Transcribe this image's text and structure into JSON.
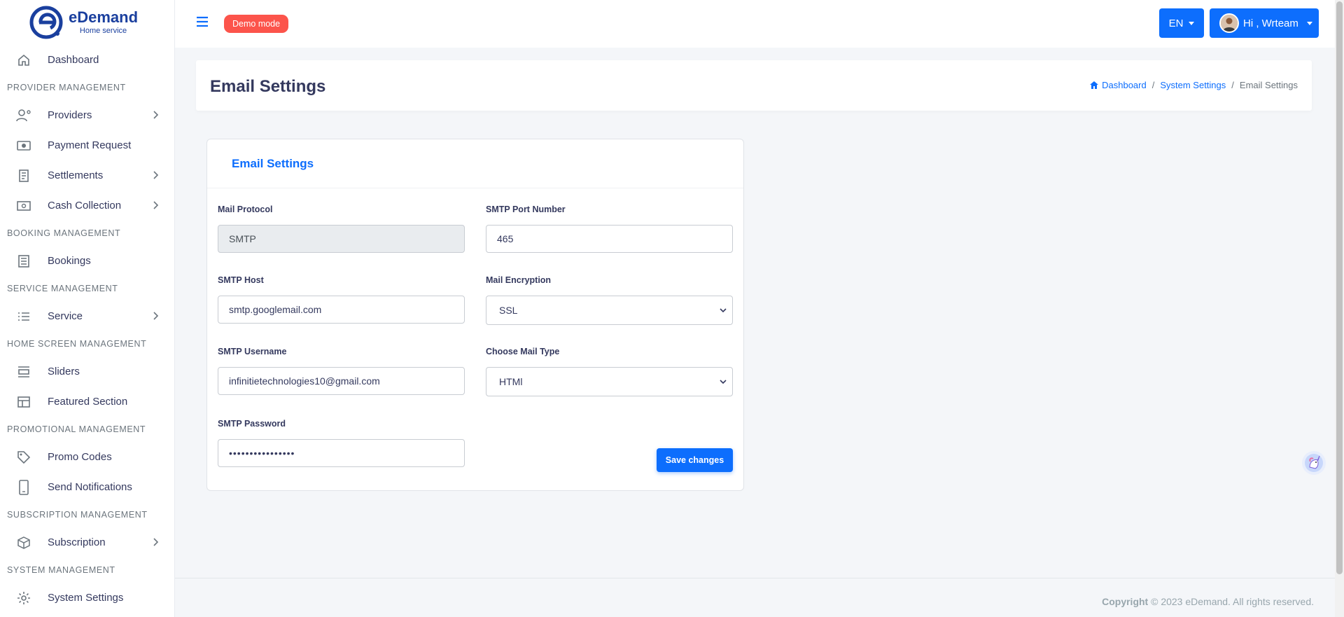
{
  "brand": {
    "name": "eDemand",
    "subtitle": "Home service"
  },
  "sidebar": {
    "items": [
      {
        "type": "item",
        "label": "Dashboard",
        "icon": "home-icon"
      },
      {
        "type": "header",
        "label": "PROVIDER MANAGEMENT"
      },
      {
        "type": "item",
        "label": "Providers",
        "icon": "user-gear-icon",
        "submenu": true
      },
      {
        "type": "item",
        "label": "Payment Request",
        "icon": "money-icon"
      },
      {
        "type": "item",
        "label": "Settlements",
        "icon": "receipt-icon",
        "submenu": true
      },
      {
        "type": "item",
        "label": "Cash Collection",
        "icon": "cash-icon",
        "submenu": true
      },
      {
        "type": "header",
        "label": "BOOKING MANAGEMENT"
      },
      {
        "type": "item",
        "label": "Bookings",
        "icon": "list-box-icon"
      },
      {
        "type": "header",
        "label": "SERVICE MANAGEMENT"
      },
      {
        "type": "item",
        "label": "Service",
        "icon": "list-icon",
        "submenu": true
      },
      {
        "type": "header",
        "label": "HOME SCREEN MANAGEMENT"
      },
      {
        "type": "item",
        "label": "Sliders",
        "icon": "slider-icon"
      },
      {
        "type": "item",
        "label": "Featured Section",
        "icon": "layout-icon"
      },
      {
        "type": "header",
        "label": "PROMOTIONAL MANAGEMENT"
      },
      {
        "type": "item",
        "label": "Promo Codes",
        "icon": "tag-icon"
      },
      {
        "type": "item",
        "label": "Send Notifications",
        "icon": "phone-icon"
      },
      {
        "type": "header",
        "label": "SUBSCRIPTION MANAGEMENT"
      },
      {
        "type": "item",
        "label": "Subscription",
        "icon": "package-icon",
        "submenu": true
      },
      {
        "type": "header",
        "label": "SYSTEM MANAGEMENT"
      },
      {
        "type": "item",
        "label": "System Settings",
        "icon": "gear-icon"
      }
    ]
  },
  "topbar": {
    "demo_badge": "Demo mode",
    "language": "EN",
    "user_greeting": "Hi , Wrteam"
  },
  "header": {
    "title": "Email Settings",
    "breadcrumb": {
      "home": "Dashboard",
      "parent": "System Settings",
      "current": "Email Settings"
    }
  },
  "form": {
    "card_title": "Email Settings",
    "mail_protocol": {
      "label": "Mail Protocol",
      "value": "SMTP"
    },
    "smtp_port": {
      "label": "SMTP Port Number",
      "value": "465"
    },
    "smtp_host": {
      "label": "SMTP Host",
      "value": "smtp.googlemail.com"
    },
    "mail_encryption": {
      "label": "Mail Encryption",
      "value": "SSL"
    },
    "smtp_username": {
      "label": "SMTP Username",
      "value": "infinitietechnologies10@gmail.com"
    },
    "mail_type": {
      "label": "Choose Mail Type",
      "value": "HTMl"
    },
    "smtp_password": {
      "label": "SMTP Password",
      "value": "••••••••••••••••"
    },
    "save_label": "Save changes"
  },
  "footer": {
    "copyright_bold": "Copyright",
    "copyright_text": " © 2023 eDemand. All rights reserved."
  },
  "colors": {
    "primary": "#0d6efd",
    "danger": "#fc544b",
    "brand": "#1a3f9e"
  }
}
